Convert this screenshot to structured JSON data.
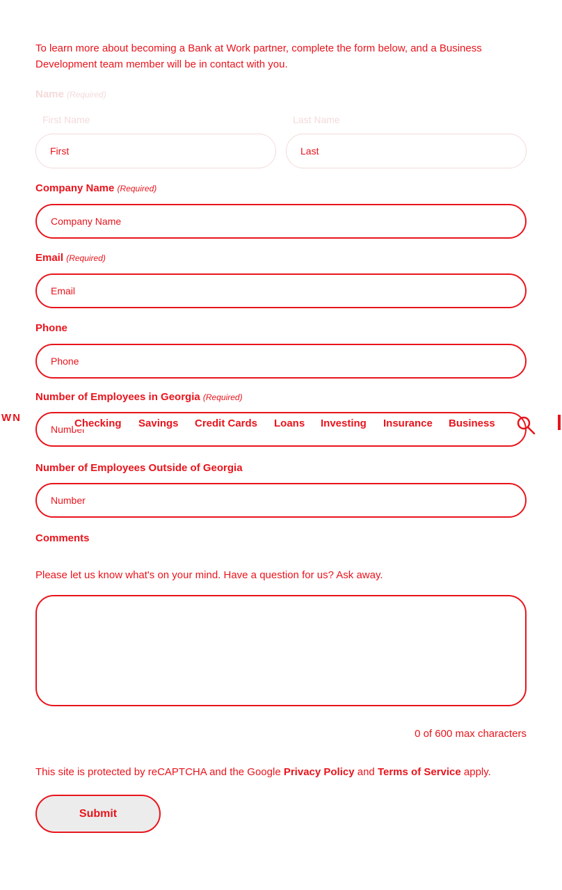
{
  "intro": "To learn more about becoming a Bank at Work partner, complete the form below, and a Business Development team member will be in contact with you.",
  "name_field": {
    "label": "Name",
    "required": "(Required)",
    "first_label": "First Name",
    "last_label": "Last Name",
    "first_placeholder": "First",
    "last_placeholder": "Last"
  },
  "company": {
    "label": "Company Name",
    "required": "(Required)",
    "placeholder": "Company Name"
  },
  "email": {
    "label": "Email",
    "required": "(Required)",
    "placeholder": "Email"
  },
  "phone": {
    "label": "Phone",
    "placeholder": "Phone"
  },
  "employees_ga": {
    "label": "Number of Employees in Georgia",
    "required": "(Required)",
    "placeholder": "Number"
  },
  "employees_out": {
    "label": "Number of Employees Outside of Georgia",
    "placeholder": "Number"
  },
  "comments": {
    "label": "Comments",
    "help": "Please let us know what's on your mind. Have a question for us? Ask away.",
    "counter": "0 of 600 max characters"
  },
  "recaptcha": {
    "prefix": "This site is protected by reCAPTCHA and the Google",
    "privacy": "Privacy Policy",
    "and": "and",
    "terms": "Terms of Service",
    "suffix": "apply."
  },
  "submit_label": "Submit",
  "nav": {
    "logo_fragment": "WN",
    "items": [
      "Checking",
      "Savings",
      "Credit Cards",
      "Loans",
      "Investing",
      "Insurance",
      "Business"
    ],
    "icon": "search-icon"
  },
  "colors": {
    "accent": "#e8141c",
    "faint": "#f4dada",
    "button_bg": "#ececec"
  }
}
